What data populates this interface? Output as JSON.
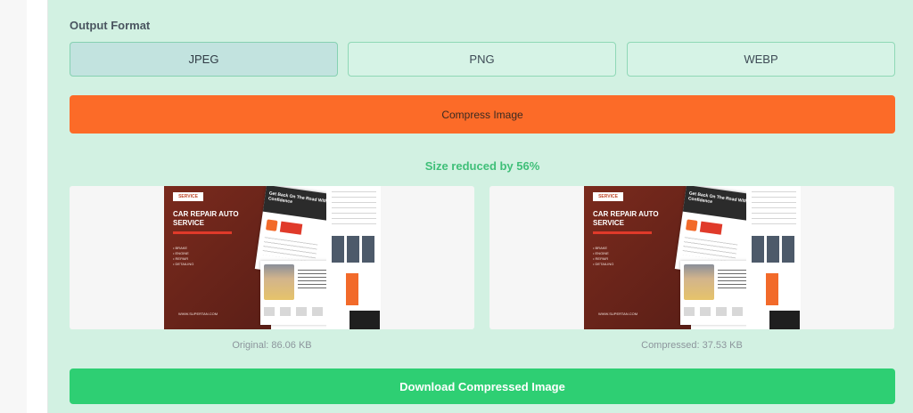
{
  "output_format": {
    "label": "Output Format",
    "options": [
      "JPEG",
      "PNG",
      "WEBP"
    ],
    "selected": "JPEG"
  },
  "compress_button": {
    "label": "Compress Image"
  },
  "result": {
    "reduction_text": "Size reduced by 56%"
  },
  "previews": {
    "original": {
      "caption": "Original: 86.06 KB",
      "image": {
        "tag": "SERVICE",
        "headline": "CAR REPAIR AUTO SERVICE",
        "card_title": "Get Back On The Road With Confidence",
        "bullets": [
          "• BRAKE",
          "• ENGINE",
          "• REPAIR",
          "• DETAILING"
        ],
        "url": "WWW.SUPERTAN.COM"
      }
    },
    "compressed": {
      "caption": "Compressed: 37.53 KB",
      "image": {
        "tag": "SERVICE",
        "headline": "CAR REPAIR AUTO SERVICE",
        "card_title": "Get Back On The Road With Confidence",
        "bullets": [
          "• BRAKE",
          "• ENGINE",
          "• REPAIR",
          "• DETAILING"
        ],
        "url": "WWW.SUPERTAN.COM"
      }
    }
  },
  "download_button": {
    "label": "Download Compressed Image"
  },
  "colors": {
    "panel_bg": "#d2f1e2",
    "compress_orange": "#fc6b28",
    "download_green": "#2ecf73",
    "reduction_green": "#3fbf78"
  }
}
